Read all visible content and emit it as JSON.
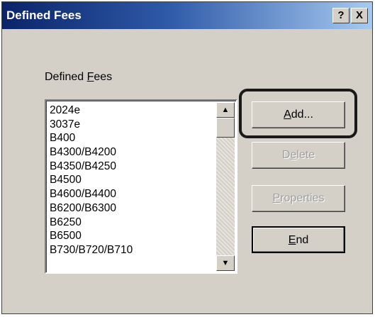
{
  "window": {
    "title": "Defined Fees",
    "help_label": "?",
    "close_label": "X"
  },
  "group_label": {
    "prefix": "Defined ",
    "hotkey": "F",
    "suffix": "ees"
  },
  "fees_list": [
    "2024e",
    "3037e",
    "B400",
    "B4300/B4200",
    "B4350/B4250",
    "B4500",
    "B4600/B4400",
    "B6200/B6300",
    "B6250",
    "B6500",
    "B730/B720/B710"
  ],
  "scrollbar": {
    "up_label": "▲",
    "down_label": "▼"
  },
  "buttons": {
    "add": {
      "hotkey": "A",
      "rest": "dd...",
      "enabled": true
    },
    "delete": {
      "prefix": "D",
      "hotkey": "e",
      "rest": "lete",
      "enabled": false
    },
    "properties": {
      "hotkey": "P",
      "rest": "roperties",
      "enabled": false
    },
    "end": {
      "hotkey": "E",
      "rest": "nd",
      "enabled": true
    }
  }
}
